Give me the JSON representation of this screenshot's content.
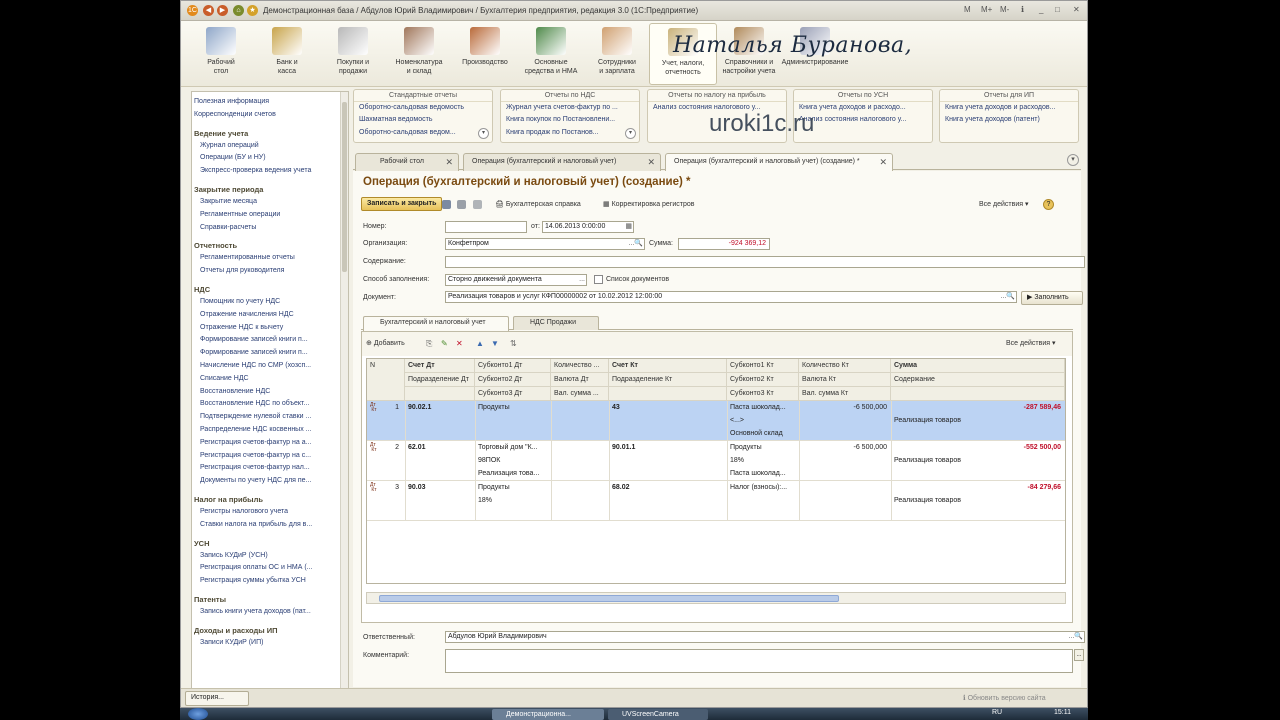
{
  "window": {
    "title": "Демонстрационная база / Абдулов Юрий Владимирович / Бухгалтерия предприятия, редакция 3.0  (1С:Предприятие)"
  },
  "sections": [
    {
      "label": "Рабочий\nстол",
      "icon": "desktop-icon"
    },
    {
      "label": "Банк и\nкасса",
      "icon": "coins-icon"
    },
    {
      "label": "Покупки и\nпродажи",
      "icon": "truck-icon"
    },
    {
      "label": "Номенклатура\nи склад",
      "icon": "warehouse-icon"
    },
    {
      "label": "Производство",
      "icon": "tools-icon"
    },
    {
      "label": "Основные\nсредства и НМА",
      "icon": "house-icon"
    },
    {
      "label": "Сотрудники\nи зарплата",
      "icon": "person-icon"
    },
    {
      "label": "Учет, налоги,\nотчетность",
      "icon": "ledger-icon"
    },
    {
      "label": "Справочники и\nнастройки учета",
      "icon": "books-icon"
    },
    {
      "label": "Администрирование",
      "icon": "admin-icon"
    }
  ],
  "overlay_signature": "Наталья Буранова,",
  "watermark": "uroki1c.ru",
  "sidebar": {
    "top": [
      "Полезная информация",
      "Корреспонденции счетов"
    ],
    "groups": [
      {
        "title": "Ведение учета",
        "items": [
          "Журнал операций",
          "Операции (БУ и НУ)",
          "Экспресс-проверка ведения учета"
        ]
      },
      {
        "title": "Закрытие периода",
        "items": [
          "Закрытие месяца",
          "Регламентные операции",
          "Справки-расчеты"
        ]
      },
      {
        "title": "Отчетность",
        "items": [
          "Регламентированные отчеты",
          "Отчеты для руководителя"
        ]
      },
      {
        "title": "НДС",
        "items": [
          "Помощник по учету НДС",
          "Отражение начисления НДС",
          "Отражение НДС к вычету",
          "Формирование записей книги п...",
          "Формирование записей книги п...",
          "Начисление НДС по СМР (хозсп...",
          "Списание НДС",
          "Восстановление НДС",
          "Восстановление НДС по объект...",
          "Подтверждение нулевой ставки ...",
          "Распределение НДС косвенных ...",
          "Регистрация счетов-фактур на а...",
          "Регистрация счетов-фактур на с...",
          "Регистрация счетов-фактур нал...",
          "Документы по учету НДС для пе..."
        ]
      },
      {
        "title": "Налог на прибыль",
        "items": [
          "Регистры налогового учета",
          "Ставки налога на прибыль для в..."
        ]
      },
      {
        "title": "УСН",
        "items": [
          "Запись КУДиР (УСН)",
          "Регистрация оплаты ОС и НМА (...",
          "Регистрация суммы убытка УСН"
        ]
      },
      {
        "title": "Патенты",
        "items": [
          "Запись книги учета доходов (пат..."
        ]
      },
      {
        "title": "Доходы и расходы ИП",
        "items": [
          "Записи КУДиР (ИП)"
        ]
      }
    ]
  },
  "report_groups": [
    {
      "title": "Стандартные отчеты",
      "items": [
        "Оборотно-сальдовая ведомость",
        "Шахматная ведомость",
        "Оборотно-сальдовая ведом..."
      ]
    },
    {
      "title": "Отчеты по НДС",
      "items": [
        "Журнал учета счетов-фактур по ...",
        "Книга покупок по Постановлени...",
        "Книга продаж по Постанов..."
      ]
    },
    {
      "title": "Отчеты по налогу на прибыль",
      "items": [
        "Анализ состояния налогового у..."
      ]
    },
    {
      "title": "Отчеты по УСН",
      "items": [
        "Книга учета доходов и расходо...",
        "Анализ состояния налогового у..."
      ]
    },
    {
      "title": "Отчеты для ИП",
      "items": [
        "Книга учета доходов и расходов...",
        "Книга учета доходов (патент)"
      ]
    }
  ],
  "doc_tabs": [
    {
      "label": "Рабочий стол"
    },
    {
      "label": "Операция (бухгалтерский и налоговый учет)"
    },
    {
      "label": "Операция (бухгалтерский и налоговый учет) (создание) *"
    }
  ],
  "form": {
    "title": "Операция (бухгалтерский и налоговый учет) (создание) *",
    "save_close": "Записать и закрыть",
    "accounting_ref": "Бухгалтерская справка",
    "reg_adjust": "Корректировка регистров",
    "all_actions": "Все действия",
    "number_label": "Номер:",
    "number_value": "",
    "from_label": "от:",
    "date_value": "14.06.2013  0:00:00",
    "org_label": "Организация:",
    "org_value": "Конфетпром",
    "sum_label": "Сумма:",
    "sum_value": "-924 369,12",
    "content_label": "Содержание:",
    "content_value": "",
    "fill_label": "Способ заполнения:",
    "fill_value": "Сторно движений документа",
    "doc_list_label": "Список документов",
    "document_label": "Документ:",
    "document_value": "Реализация товаров и услуг КФП00000002 от 10.02.2012 12:00:00",
    "fill_button": "Заполнить",
    "responsible_label": "Ответственный:",
    "responsible_value": "Абдулов Юрий Владимирович",
    "comment_label": "Комментарий:",
    "comment_value": ""
  },
  "inner_tabs": [
    "Бухгалтерский и налоговый учет",
    "НДС Продажи"
  ],
  "grid": {
    "add_button": "Добавить",
    "all_actions": "Все действия",
    "headers": {
      "n": "N",
      "r1": [
        "Счет Дт",
        "Субконто1 Дт",
        "Количество ...",
        "Счет Кт",
        "Субконто1 Кт",
        "Количество Кт",
        "Сумма"
      ],
      "r2": [
        "Подразделение Дт",
        "Субконто2 Дт",
        "Валюта Дт",
        "Подразделение Кт",
        "Субконто2 Кт",
        "Валюта Кт",
        "Содержание"
      ],
      "r3": [
        "",
        "Субконто3 Дт",
        "Вал. сумма ...",
        "",
        "Субконто3 Кт",
        "Вал. сумма Кт",
        ""
      ]
    },
    "rows": [
      {
        "n": "1",
        "acc_dt": "90.02.1",
        "sub1_dt": "Продукты",
        "sub2_dt": "",
        "sub3_dt": "",
        "acc_kt": "43",
        "sub1_kt": "Паста шоколад...",
        "sub2_kt": "<...>",
        "sub3_kt": "Основной склад",
        "qty_kt": "-6 500,000",
        "sum": "-287 589,46",
        "content": "Реализация товаров"
      },
      {
        "n": "2",
        "acc_dt": "62.01",
        "sub1_dt": "Торговый дом \"К...",
        "sub2_dt": "98ПОК",
        "sub3_dt": "Реализация това...",
        "acc_kt": "90.01.1",
        "sub1_kt": "Продукты",
        "sub2_kt": "18%",
        "sub3_kt": "Паста шоколад...",
        "qty_kt": "-6 500,000",
        "sum": "-552 500,00",
        "content": "Реализация товаров"
      },
      {
        "n": "3",
        "acc_dt": "90.03",
        "sub1_dt": "Продукты",
        "sub2_dt": "18%",
        "sub3_dt": "",
        "acc_kt": "68.02",
        "sub1_kt": "Налог (взносы):...",
        "sub2_kt": "",
        "sub3_kt": "",
        "qty_kt": "",
        "sum": "-84 279,66",
        "content": "Реализация товаров"
      }
    ]
  },
  "statusbar": {
    "history": "История...",
    "notice": "Обновить версию сайта"
  },
  "taskbar": {
    "app1": "Демонстрационна...",
    "app2": "UVScreenCamera",
    "lang": "RU",
    "time": "15:11"
  },
  "colors": {
    "accent": "#7a4a10",
    "selected_row": "#bcd3f3",
    "negative": "#c0102a",
    "link": "#2a3e74"
  }
}
